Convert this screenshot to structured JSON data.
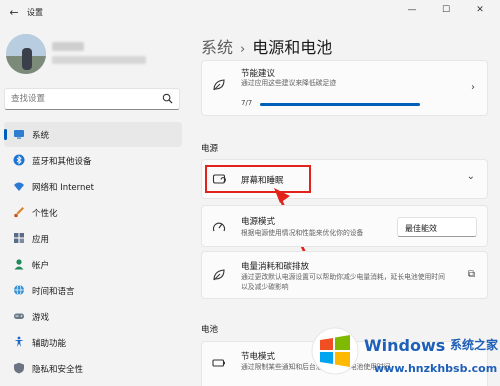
{
  "window": {
    "title": "设置",
    "back_glyph": "←",
    "minimize_glyph": "—",
    "maximize_glyph": "☐",
    "close_glyph": "✕"
  },
  "search": {
    "placeholder": "查找设置"
  },
  "sidebar": {
    "items": [
      {
        "label": "系统",
        "icon": "system-icon",
        "active": true
      },
      {
        "label": "蓝牙和其他设备",
        "icon": "bluetooth-icon"
      },
      {
        "label": "网络和 Internet",
        "icon": "wifi-icon"
      },
      {
        "label": "个性化",
        "icon": "brush-icon"
      },
      {
        "label": "应用",
        "icon": "apps-icon"
      },
      {
        "label": "帐户",
        "icon": "account-icon"
      },
      {
        "label": "时间和语言",
        "icon": "globe-icon"
      },
      {
        "label": "游戏",
        "icon": "gamepad-icon"
      },
      {
        "label": "辅助功能",
        "icon": "accessibility-icon"
      },
      {
        "label": "隐私和安全性",
        "icon": "shield-icon"
      }
    ]
  },
  "breadcrumb": {
    "parent": "系统",
    "separator": "›",
    "current": "电源和电池"
  },
  "energy_recommendations": {
    "title": "节能建议",
    "subtitle": "通过应用这些建议来降低碳足迹",
    "progress_text": "7/7",
    "progress_fraction": 1.0,
    "chevron": "›"
  },
  "power_section": {
    "label": "电源",
    "screen_sleep": {
      "title": "屏幕和睡眠",
      "chevron": "⌄"
    },
    "power_mode": {
      "title": "电源模式",
      "subtitle": "根据电源使用情况和性能来优化你的设备",
      "selected": "最佳能效",
      "dropdown_glyph": "⌄"
    },
    "energy_usage": {
      "title": "电量消耗和碳排放",
      "subtitle": "通过更改默认电源设置可以帮助你减少电量消耗，延长电池使用时间以及减少碳影响",
      "link_glyph": "⧉"
    }
  },
  "battery_section": {
    "label": "电池",
    "saver": {
      "title": "节电模式",
      "subtitle": "通过限制某些通知和后台活动来延长电池使用时间"
    }
  },
  "watermark": {
    "brand": "Windows",
    "cn": "系统之家",
    "url": "www.hnzkhbsb.com"
  },
  "colors": {
    "accent": "#005fb8",
    "highlight": "#e2231a"
  }
}
